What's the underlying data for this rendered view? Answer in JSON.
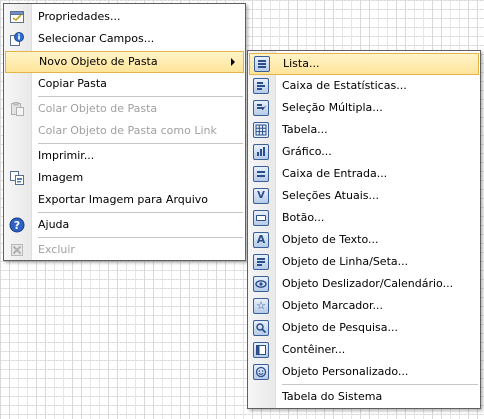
{
  "main_menu": {
    "items": [
      {
        "label": "Propriedades...",
        "icon": "properties-icon"
      },
      {
        "label": "Selecionar Campos...",
        "icon": "select-fields-icon"
      },
      {
        "label": "Novo Objeto de Pasta",
        "icon": "",
        "submenu": true,
        "highlighted": true
      },
      {
        "label": "Copiar Pasta",
        "icon": ""
      },
      {
        "label": "Colar Objeto de Pasta",
        "icon": "paste-icon",
        "disabled": true
      },
      {
        "label": "Colar Objeto de Pasta como Link",
        "icon": "",
        "disabled": true
      },
      {
        "label": "Imprimir...",
        "icon": ""
      },
      {
        "label": "Imagem",
        "icon": "image-copy-icon"
      },
      {
        "label": "Exportar Imagem para Arquivo",
        "icon": ""
      },
      {
        "label": "Ajuda",
        "icon": "help-icon"
      },
      {
        "label": "Excluir",
        "icon": "delete-icon",
        "disabled": true
      }
    ]
  },
  "sub_menu": {
    "items": [
      {
        "label": "Lista...",
        "icon": "list-box-icon",
        "highlighted": true
      },
      {
        "label": "Caixa de Estatísticas...",
        "icon": "statistics-box-icon"
      },
      {
        "label": "Seleção Múltipla...",
        "icon": "multi-box-icon"
      },
      {
        "label": "Tabela...",
        "icon": "table-box-icon"
      },
      {
        "label": "Gráfico...",
        "icon": "chart-icon"
      },
      {
        "label": "Caixa de Entrada...",
        "icon": "input-box-icon"
      },
      {
        "label": "Seleções Atuais...",
        "icon": "current-selections-icon"
      },
      {
        "label": "Botão...",
        "icon": "button-icon"
      },
      {
        "label": "Objeto de Texto...",
        "icon": "text-object-icon"
      },
      {
        "label": "Objeto de Linha/Seta...",
        "icon": "line-arrow-icon"
      },
      {
        "label": "Objeto Deslizador/Calendário...",
        "icon": "slider-calendar-icon"
      },
      {
        "label": "Objeto Marcador...",
        "icon": "bookmark-icon"
      },
      {
        "label": "Objeto de Pesquisa...",
        "icon": "search-object-icon"
      },
      {
        "label": "Contêiner...",
        "icon": "container-icon"
      },
      {
        "label": "Objeto Personalizado...",
        "icon": "custom-object-icon"
      },
      {
        "label": "Tabela do Sistema",
        "icon": ""
      }
    ]
  },
  "colors": {
    "highlight_top": "#fff4c8",
    "highlight_bottom": "#ffe49a",
    "highlight_border": "#e3b44a",
    "icon_blue": "#2b4f8a",
    "disabled_text": "#a0a0a0"
  }
}
